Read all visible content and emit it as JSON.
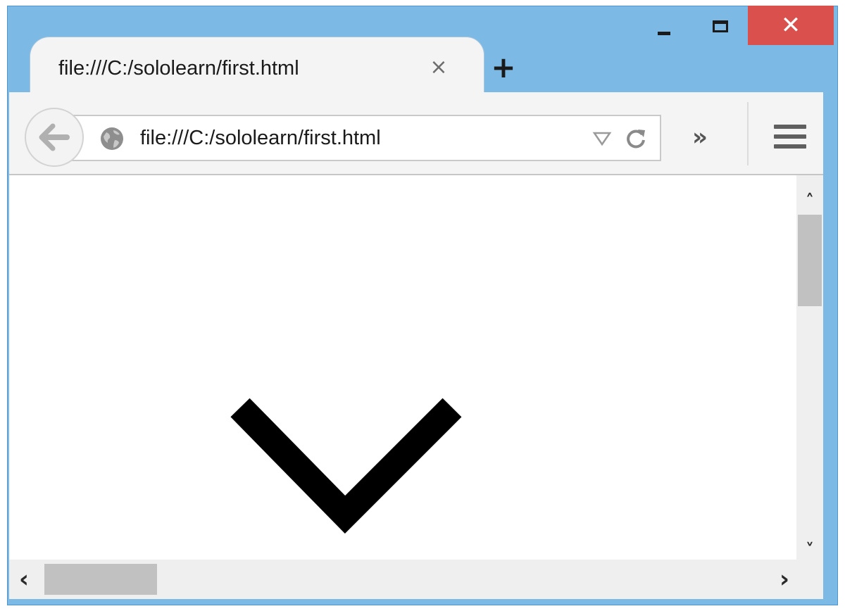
{
  "window": {
    "caption_buttons": {
      "minimize": "minimize-icon",
      "maximize": "maximize-icon",
      "close": "close-icon"
    },
    "close_color": "#d9504d",
    "frame_color": "#7cb9e4"
  },
  "tab": {
    "title": "file:///C:/sololearn/first.html",
    "close_glyph": "×",
    "new_tab_glyph": "+"
  },
  "toolbar": {
    "url": "file:///C:/sololearn/first.html",
    "overflow_glyph": "»",
    "icons": [
      "back-arrow-icon",
      "globe-icon",
      "dropdown-triangle-icon",
      "reload-icon",
      "hamburger-menu-icon"
    ]
  },
  "content": {
    "drawing": "chevron-down-shape"
  },
  "scrollbars": {
    "up_glyph": "˄",
    "down_glyph": "˅",
    "left_glyph": "‹",
    "right_glyph": "›"
  }
}
